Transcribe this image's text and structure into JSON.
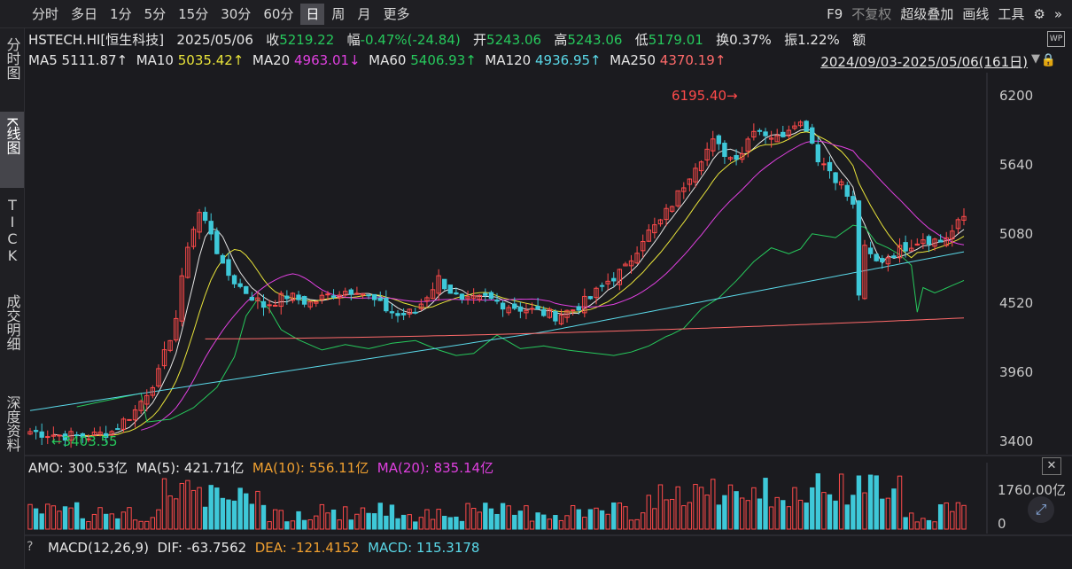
{
  "toolbar": {
    "periods": [
      "分时",
      "多日",
      "1分",
      "5分",
      "15分",
      "30分",
      "60分",
      "日",
      "周",
      "月",
      "更多"
    ],
    "active_period": "日",
    "right_items": [
      "F9",
      "不复权",
      "超级叠加",
      "画线",
      "工具"
    ],
    "gear_icon": "gear-icon",
    "more_icon": "double-chevron-right-icon"
  },
  "sidebar": [
    "分时图",
    "K线图",
    "TICK",
    "成交明细",
    "深度资料"
  ],
  "quote": {
    "symbol": "HSTECH.HI[恒生科技]",
    "date": "2025/05/06",
    "close_label": "收",
    "close": "5219.22",
    "change_label": "幅",
    "change": "-0.47%(-24.84)",
    "open_label": "开",
    "open": "5243.06",
    "high_label": "高",
    "high": "5243.06",
    "low_label": "低",
    "low": "5179.01",
    "turnover_label": "换",
    "turnover": "0.37%",
    "amplitude_label": "振",
    "amplitude": "1.22%",
    "amount_label": "额"
  },
  "ma_legend": [
    {
      "name": "MA5",
      "value": "5111.87↑",
      "color": "#e6e6e6"
    },
    {
      "name": "MA10",
      "value": "5035.42↑",
      "color": "#e8e33a"
    },
    {
      "name": "MA20",
      "value": "4963.01↓",
      "color": "#e040e0"
    },
    {
      "name": "MA60",
      "value": "5406.93↑",
      "color": "#26c95c"
    },
    {
      "name": "MA120",
      "value": "4936.95↑",
      "color": "#5ad8e8"
    },
    {
      "name": "MA250",
      "value": "4370.19↑",
      "color": "#ff6a6a"
    }
  ],
  "date_range": "2024/09/03-2025/05/06(161日)",
  "chart_data": {
    "type": "candlestick",
    "y_ticks": [
      6200,
      5640,
      5080,
      4520,
      3960,
      3400
    ],
    "ylim": [
      3400,
      6200
    ],
    "max_annotation": "6195.40",
    "min_annotation": "3403.55",
    "ma250_range": [
      4230,
      4400
    ],
    "ma120_range": [
      3650,
      4937
    ],
    "volume_ticks": [
      "1760.00亿",
      "0"
    ]
  },
  "amo": {
    "label": "AMO: 300.53亿",
    "ma5": "MA(5): 421.71亿",
    "ma10": "MA(10): 556.11亿",
    "ma20": "MA(20): 835.14亿"
  },
  "macd": {
    "label": "MACD(12,26,9)",
    "dif": "DIF: -63.7562",
    "dea": "DEA: -121.4152",
    "macd": "MACD: 115.3178"
  },
  "colors": {
    "up": "#ff4a4a",
    "down": "#3ec8d8",
    "bg": "#1b1b1f"
  }
}
